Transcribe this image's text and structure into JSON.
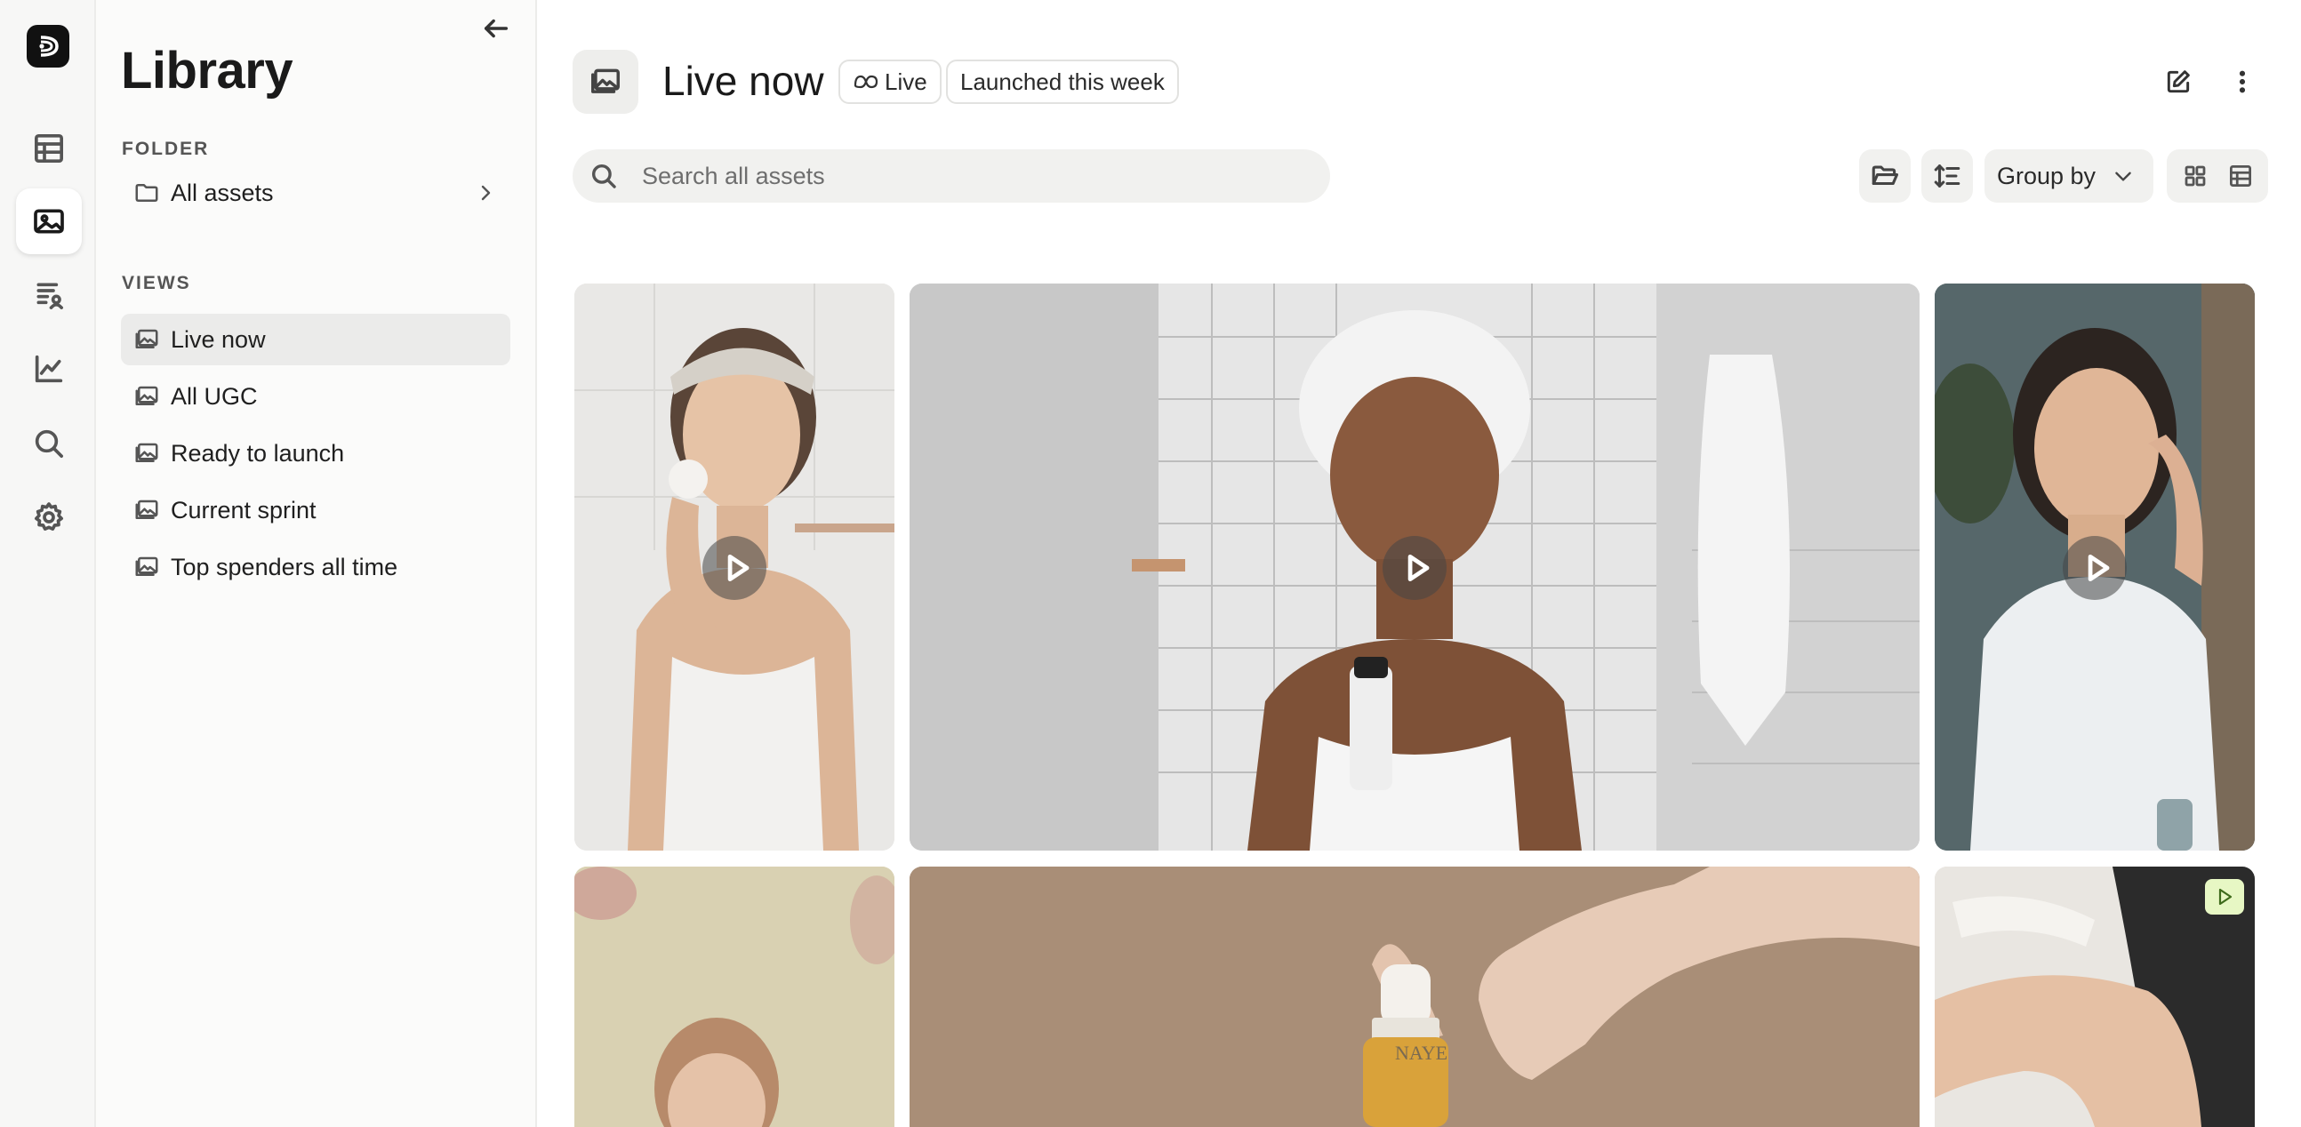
{
  "sidebar": {
    "title": "Library",
    "folder_label": "FOLDER",
    "folder_item": "All assets",
    "views_label": "VIEWS",
    "views": [
      {
        "label": "Live now",
        "active": true
      },
      {
        "label": "All UGC",
        "active": false
      },
      {
        "label": "Ready to launch",
        "active": false
      },
      {
        "label": "Current sprint",
        "active": false
      },
      {
        "label": "Top spenders all time",
        "active": false
      }
    ]
  },
  "header": {
    "title": "Live now",
    "chips": {
      "live": "Live",
      "launched": "Launched this week"
    }
  },
  "toolbar": {
    "search_placeholder": "Search all assets",
    "group_by_label": "Group by"
  },
  "grid": {
    "cards": [
      {
        "kind": "video",
        "subject": "woman-applying-cotton-pad"
      },
      {
        "kind": "video",
        "subject": "woman-with-towel-holding-bottle"
      },
      {
        "kind": "video",
        "subject": "woman-touching-face"
      },
      {
        "kind": "image",
        "subject": "woman-portrait-beige"
      },
      {
        "kind": "image",
        "subject": "hand-holding-serum-bottle",
        "bottle_text": "NAYE"
      },
      {
        "kind": "image",
        "subject": "legs-on-white-sheets",
        "badge": "play-icon"
      }
    ]
  },
  "colors": {
    "accent_badge": "#e7f7c4",
    "active_row": "#ebebea",
    "background": "#ffffff"
  }
}
